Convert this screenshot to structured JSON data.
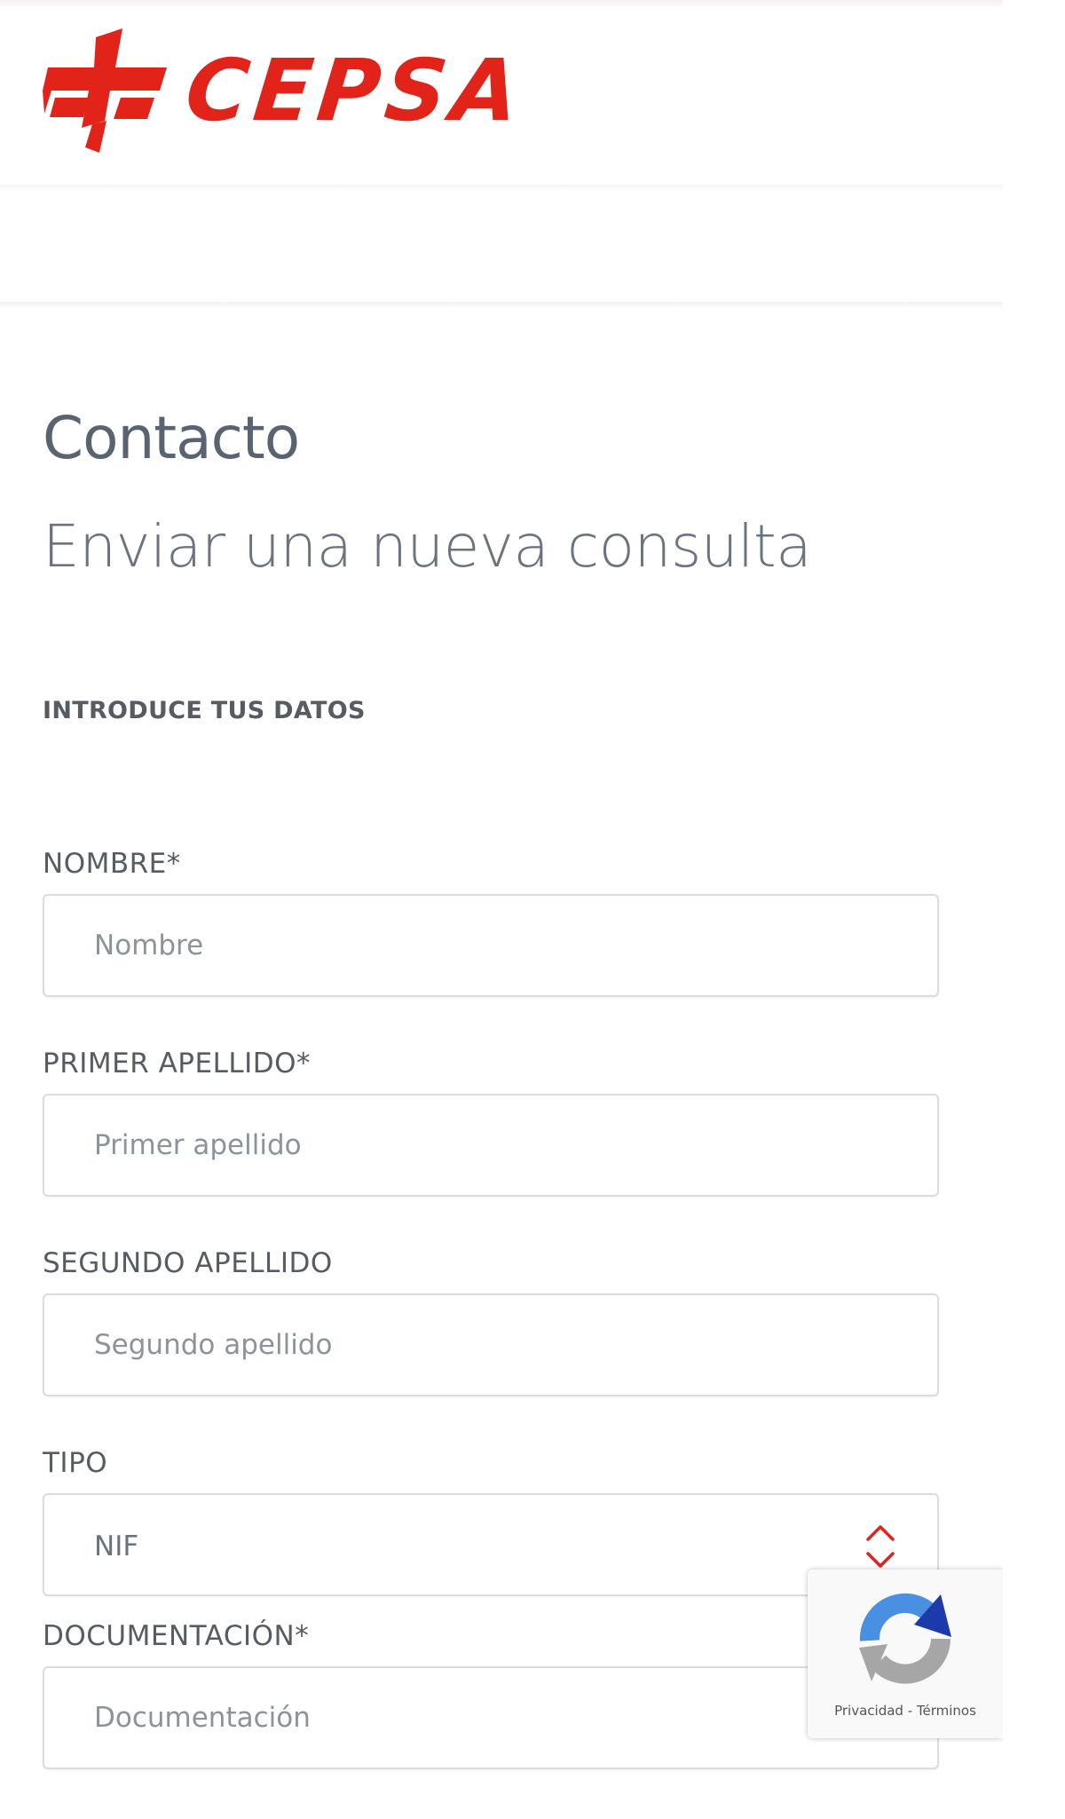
{
  "brand": {
    "name": "CEPSA",
    "color": "#e2231a"
  },
  "page": {
    "title": "Contacto",
    "subtitle": "Enviar una nueva consulta"
  },
  "form": {
    "section_label": "INTRODUCE TUS DATOS",
    "fields": {
      "nombre": {
        "label": "NOMBRE*",
        "placeholder": "Nombre",
        "value": ""
      },
      "primer_apellido": {
        "label": "PRIMER APELLIDO*",
        "placeholder": "Primer apellido",
        "value": ""
      },
      "segundo_apellido": {
        "label": "SEGUNDO APELLIDO",
        "placeholder": "Segundo apellido",
        "value": ""
      },
      "tipo": {
        "label": "TIPO",
        "selected": "NIF",
        "arrow_icon": "updown-chevron-icon",
        "arrow_color": "#e2231a"
      },
      "documentacion": {
        "label": "DOCUMENTACIÓN*",
        "placeholder": "Documentación",
        "value": ""
      }
    }
  },
  "recaptcha": {
    "icon": "recaptcha-icon",
    "terms": "Privacidad - Términos"
  }
}
